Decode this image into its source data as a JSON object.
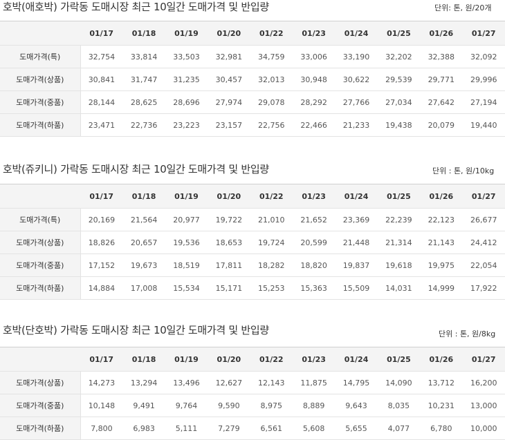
{
  "sections": [
    {
      "title": "호박(애호박) 가락동 도매시장 최근 10일간 도매가격 및 반입량",
      "unit": "단위: 톤, 원/20개",
      "dates": [
        "01/17",
        "01/18",
        "01/19",
        "01/20",
        "01/22",
        "01/23",
        "01/24",
        "01/25",
        "01/26",
        "01/27"
      ],
      "rows": [
        {
          "label": "도매가격(특)",
          "values": [
            "32,754",
            "33,814",
            "33,503",
            "32,981",
            "34,759",
            "33,006",
            "33,190",
            "32,202",
            "32,388",
            "32,092"
          ]
        },
        {
          "label": "도매가격(상품)",
          "values": [
            "30,841",
            "31,747",
            "31,235",
            "30,457",
            "32,013",
            "30,948",
            "30,622",
            "29,539",
            "29,771",
            "29,996"
          ]
        },
        {
          "label": "도매가격(중품)",
          "values": [
            "28,144",
            "28,625",
            "28,696",
            "27,974",
            "29,078",
            "28,292",
            "27,766",
            "27,034",
            "27,642",
            "27,194"
          ]
        },
        {
          "label": "도매가격(하품)",
          "values": [
            "23,471",
            "22,736",
            "23,223",
            "23,157",
            "22,756",
            "22,466",
            "21,233",
            "19,438",
            "20,079",
            "19,440"
          ]
        }
      ]
    },
    {
      "title": "호박(쥬키니) 가락동 도매시장 최근 10일간 도매가격 및 반입량",
      "unit": "단위 : 톤, 원/10kg",
      "dates": [
        "01/17",
        "01/18",
        "01/19",
        "01/20",
        "01/22",
        "01/23",
        "01/24",
        "01/25",
        "01/26",
        "01/27"
      ],
      "rows": [
        {
          "label": "도매가격(특)",
          "values": [
            "20,169",
            "21,564",
            "20,977",
            "19,722",
            "21,010",
            "21,652",
            "23,369",
            "22,239",
            "22,123",
            "26,677"
          ]
        },
        {
          "label": "도매가격(상품)",
          "values": [
            "18,826",
            "20,657",
            "19,536",
            "18,653",
            "19,724",
            "20,599",
            "21,448",
            "21,314",
            "21,143",
            "24,412"
          ]
        },
        {
          "label": "도매가격(중품)",
          "values": [
            "17,152",
            "19,673",
            "18,519",
            "17,811",
            "18,282",
            "18,820",
            "19,837",
            "19,618",
            "19,975",
            "22,054"
          ]
        },
        {
          "label": "도매가격(하품)",
          "values": [
            "14,884",
            "17,008",
            "15,534",
            "15,171",
            "15,253",
            "15,363",
            "15,509",
            "14,031",
            "14,999",
            "17,922"
          ]
        }
      ]
    },
    {
      "title": "호박(단호박) 가락동 도매시장 최근 10일간 도매가격 및 반입량",
      "unit": "단위 : 톤, 원/8kg",
      "dates": [
        "01/17",
        "01/18",
        "01/19",
        "01/20",
        "01/22",
        "01/23",
        "01/24",
        "01/25",
        "01/26",
        "01/27"
      ],
      "rows": [
        {
          "label": "도매가격(상품)",
          "values": [
            "14,273",
            "13,294",
            "13,496",
            "12,627",
            "12,143",
            "11,875",
            "14,795",
            "14,090",
            "13,712",
            "16,200"
          ]
        },
        {
          "label": "도매가격(중품)",
          "values": [
            "10,148",
            "9,491",
            "9,764",
            "9,590",
            "8,975",
            "8,889",
            "9,643",
            "8,035",
            "10,231",
            "13,000"
          ]
        },
        {
          "label": "도매가격(하품)",
          "values": [
            "7,800",
            "6,983",
            "5,111",
            "7,279",
            "6,561",
            "5,608",
            "5,655",
            "4,077",
            "6,780",
            "10,000"
          ]
        }
      ]
    }
  ]
}
